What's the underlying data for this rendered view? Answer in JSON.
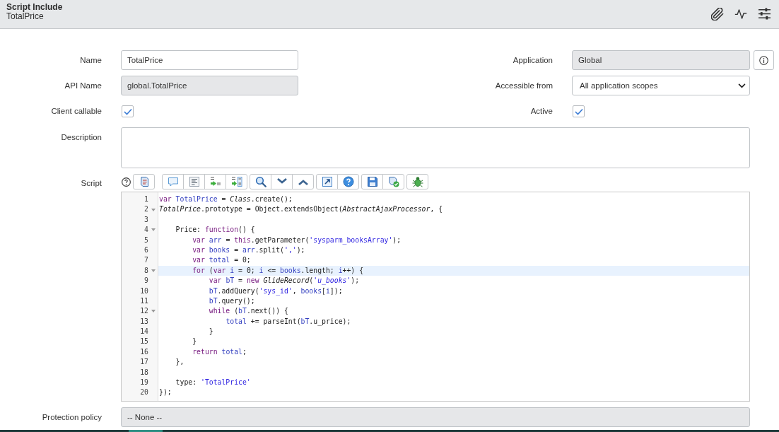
{
  "header": {
    "title": "Script Include",
    "subtitle": "TotalPrice"
  },
  "rows": [
    {
      "fields": [
        {
          "label": "Name",
          "kind": "text",
          "value": "TotalPrice",
          "readonly": false
        },
        {
          "label": "Application",
          "kind": "reference",
          "value": "Global",
          "readonly": true
        }
      ]
    },
    {
      "fields": [
        {
          "label": "API Name",
          "kind": "text",
          "value": "global.TotalPrice",
          "readonly": true
        },
        {
          "label": "Accessible from",
          "kind": "select",
          "value": "All application scopes",
          "readonly": false
        }
      ]
    },
    {
      "fields": [
        {
          "label": "Client callable",
          "kind": "checkbox",
          "checked": true
        },
        {
          "label": "Active",
          "kind": "checkbox",
          "checked": true
        }
      ]
    },
    {
      "fields": [
        {
          "label": "Description",
          "kind": "textarea",
          "readonly": false
        }
      ]
    },
    {
      "fields": [
        {
          "label": "Script",
          "kind": "script",
          "readonly": false,
          "lines": [
            {
              "number": "1",
              "foldable": false,
              "current": false,
              "tokens": [
                {
                  "kind": "keyword",
                  "text": "var "
                },
                {
                  "kind": "variable",
                  "text": "TotalPrice"
                },
                {
                  "kind": "plain",
                  "text": " = "
                },
                {
                  "kind": "global",
                  "text": "Class"
                },
                {
                  "kind": "plain",
                  "text": ".create();"
                }
              ]
            },
            {
              "number": "2",
              "foldable": true,
              "current": false,
              "tokens": [
                {
                  "kind": "global",
                  "text": "TotalPrice"
                },
                {
                  "kind": "plain",
                  "text": ".prototype = Object.extendsObject("
                },
                {
                  "kind": "global",
                  "text": "AbstractAjaxProcessor"
                },
                {
                  "kind": "plain",
                  "text": ", {"
                }
              ]
            },
            {
              "number": "3",
              "foldable": false,
              "current": false
            },
            {
              "number": "4",
              "foldable": true,
              "current": false,
              "tokens": [
                {
                  "kind": "plain",
                  "text": "    Price: "
                },
                {
                  "kind": "keyword",
                  "text": "function"
                },
                {
                  "kind": "plain",
                  "text": "() {"
                }
              ]
            },
            {
              "number": "5",
              "foldable": false,
              "current": false,
              "tokens": [
                {
                  "kind": "keyword",
                  "text": "        var "
                },
                {
                  "kind": "variable",
                  "text": "arr"
                },
                {
                  "kind": "plain",
                  "text": " = "
                },
                {
                  "kind": "keyword",
                  "text": "this"
                },
                {
                  "kind": "plain",
                  "text": ".getParameter("
                },
                {
                  "kind": "string",
                  "text": "'sysparm_booksArray'"
                },
                {
                  "kind": "plain",
                  "text": ");"
                }
              ]
            },
            {
              "number": "6",
              "foldable": false,
              "current": false,
              "tokens": [
                {
                  "kind": "keyword",
                  "text": "        var "
                },
                {
                  "kind": "variable",
                  "text": "books"
                },
                {
                  "kind": "plain",
                  "text": " = "
                },
                {
                  "kind": "variable",
                  "text": "arr"
                },
                {
                  "kind": "plain",
                  "text": ".split("
                },
                {
                  "kind": "string",
                  "text": "','"
                },
                {
                  "kind": "plain",
                  "text": ");"
                }
              ]
            },
            {
              "number": "7",
              "foldable": false,
              "current": false,
              "tokens": [
                {
                  "kind": "keyword",
                  "text": "        var "
                },
                {
                  "kind": "variable",
                  "text": "total"
                },
                {
                  "kind": "plain",
                  "text": " = 0;"
                }
              ]
            },
            {
              "number": "8",
              "foldable": true,
              "current": true,
              "tokens": [
                {
                  "kind": "keyword",
                  "text": "        for"
                },
                {
                  "kind": "plain",
                  "text": " ("
                },
                {
                  "kind": "keyword",
                  "text": "var "
                },
                {
                  "kind": "variable",
                  "text": "i"
                },
                {
                  "kind": "plain",
                  "text": " = 0; "
                },
                {
                  "kind": "variable",
                  "text": "i"
                },
                {
                  "kind": "plain",
                  "text": " <= "
                },
                {
                  "kind": "variable",
                  "text": "books"
                },
                {
                  "kind": "plain",
                  "text": ".length; "
                },
                {
                  "kind": "variable",
                  "text": "i"
                },
                {
                  "kind": "plain",
                  "text": "++) {"
                }
              ]
            },
            {
              "number": "9",
              "foldable": false,
              "current": false,
              "tokens": [
                {
                  "kind": "keyword",
                  "text": "            var "
                },
                {
                  "kind": "variable",
                  "text": "bT"
                },
                {
                  "kind": "plain",
                  "text": " = "
                },
                {
                  "kind": "keyword",
                  "text": "new "
                },
                {
                  "kind": "global",
                  "text": "GlideRecord"
                },
                {
                  "kind": "plain",
                  "text": "("
                },
                {
                  "kind": "italic-string",
                  "text": "'u_books'"
                },
                {
                  "kind": "plain",
                  "text": ");"
                }
              ]
            },
            {
              "number": "10",
              "foldable": false,
              "current": false,
              "tokens": [
                {
                  "kind": "variable",
                  "text": "            bT"
                },
                {
                  "kind": "plain",
                  "text": ".addQuery("
                },
                {
                  "kind": "string",
                  "text": "'sys_id'"
                },
                {
                  "kind": "plain",
                  "text": ", "
                },
                {
                  "kind": "variable",
                  "text": "books"
                },
                {
                  "kind": "plain",
                  "text": "["
                },
                {
                  "kind": "variable",
                  "text": "i"
                },
                {
                  "kind": "plain",
                  "text": "]);"
                }
              ]
            },
            {
              "number": "11",
              "foldable": false,
              "current": false,
              "tokens": [
                {
                  "kind": "variable",
                  "text": "            bT"
                },
                {
                  "kind": "plain",
                  "text": ".query();"
                }
              ]
            },
            {
              "number": "12",
              "foldable": true,
              "current": false,
              "tokens": [
                {
                  "kind": "keyword",
                  "text": "            while"
                },
                {
                  "kind": "plain",
                  "text": " ("
                },
                {
                  "kind": "variable",
                  "text": "bT"
                },
                {
                  "kind": "plain",
                  "text": ".next()) {"
                }
              ]
            },
            {
              "number": "13",
              "foldable": false,
              "current": false,
              "tokens": [
                {
                  "kind": "variable",
                  "text": "                total"
                },
                {
                  "kind": "plain",
                  "text": " += parseInt("
                },
                {
                  "kind": "variable",
                  "text": "bT"
                },
                {
                  "kind": "plain",
                  "text": ".u_price);"
                }
              ]
            },
            {
              "number": "14",
              "foldable": false,
              "current": false,
              "tokens": [
                {
                  "kind": "plain",
                  "text": "            }"
                }
              ]
            },
            {
              "number": "15",
              "foldable": false,
              "current": false,
              "tokens": [
                {
                  "kind": "plain",
                  "text": "        }"
                }
              ]
            },
            {
              "number": "16",
              "foldable": false,
              "current": false,
              "tokens": [
                {
                  "kind": "keyword",
                  "text": "        return "
                },
                {
                  "kind": "variable",
                  "text": "total"
                },
                {
                  "kind": "plain",
                  "text": ";"
                }
              ]
            },
            {
              "number": "17",
              "foldable": false,
              "current": false,
              "tokens": [
                {
                  "kind": "plain",
                  "text": "    },"
                }
              ]
            },
            {
              "number": "18",
              "foldable": false,
              "current": false
            },
            {
              "number": "19",
              "foldable": false,
              "current": false,
              "tokens": [
                {
                  "kind": "plain",
                  "text": "    type: "
                },
                {
                  "kind": "string",
                  "text": "'TotalPrice'"
                }
              ]
            },
            {
              "number": "20",
              "foldable": false,
              "current": false,
              "tokens": [
                {
                  "kind": "plain",
                  "text": "});"
                }
              ]
            }
          ]
        }
      ]
    },
    {
      "fields": [
        {
          "label": "Protection policy",
          "kind": "select",
          "value": "-- None --",
          "readonly": true
        }
      ]
    }
  ]
}
